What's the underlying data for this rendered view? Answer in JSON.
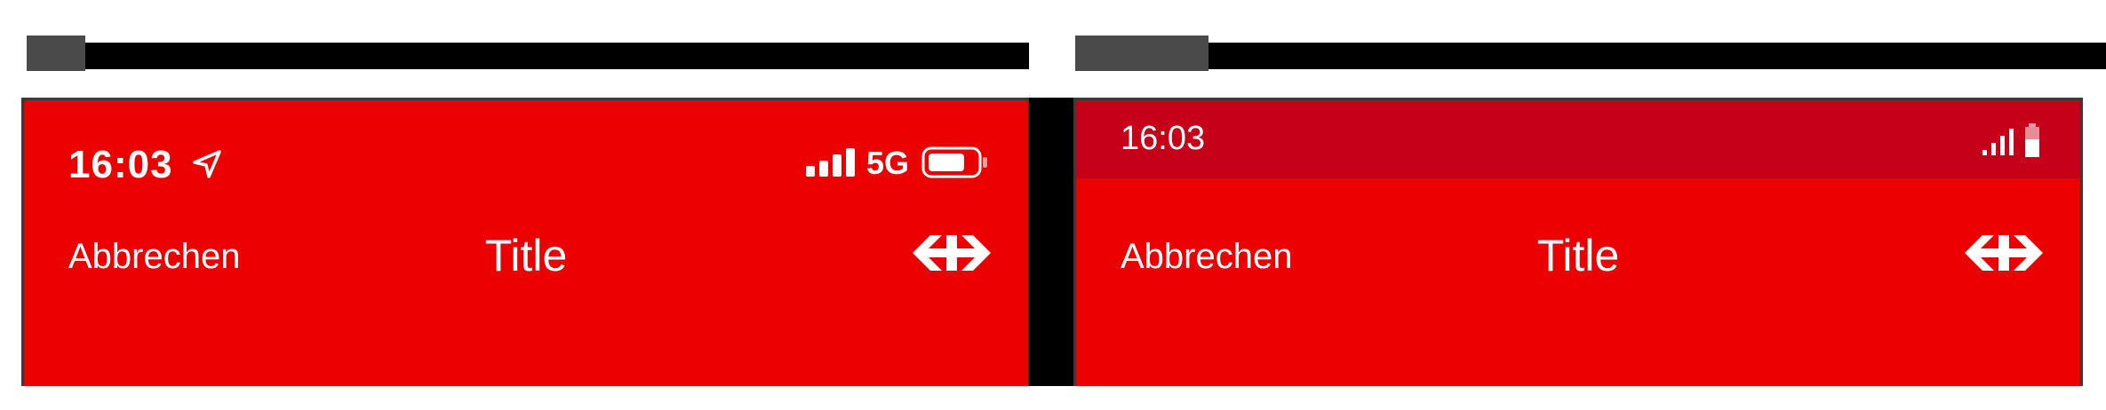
{
  "labels": {
    "ios": "",
    "android": ""
  },
  "ios": {
    "status": {
      "time": "16:03",
      "network": "5G",
      "icons": [
        "location-arrow-icon",
        "cellular-signal-icon",
        "battery-icon"
      ]
    },
    "nav": {
      "cancel_label": "Abbrechen",
      "title": "Title",
      "logo_icon": "sbb-logo-icon"
    }
  },
  "android": {
    "status": {
      "time": "16:03",
      "icons": [
        "cellular-signal-icon",
        "battery-icon"
      ]
    },
    "nav": {
      "cancel_label": "Abbrechen",
      "title": "Title",
      "logo_icon": "sbb-logo-icon"
    }
  },
  "colors": {
    "brand_red": "#eb0000",
    "android_status_red": "#c60018",
    "text_white": "#ffffff"
  }
}
